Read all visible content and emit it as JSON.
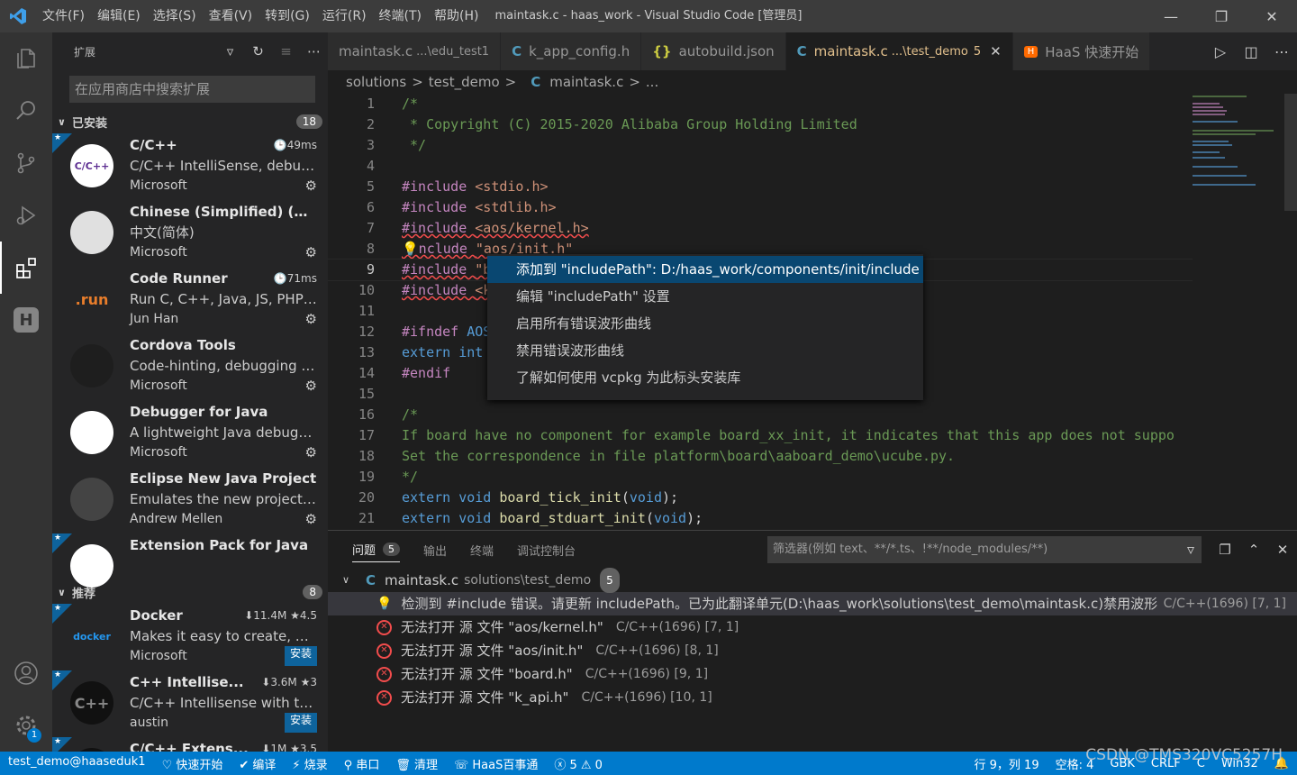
{
  "window": {
    "title": "maintask.c - haas_work - Visual Studio Code [管理员]",
    "menu": [
      "文件(F)",
      "编辑(E)",
      "选择(S)",
      "查看(V)",
      "转到(G)",
      "运行(R)",
      "终端(T)",
      "帮助(H)"
    ]
  },
  "sidebar": {
    "title": "扩展",
    "search_placeholder": "在应用商店中搜索扩展",
    "installed": {
      "label": "已安装",
      "count": "18",
      "items": [
        {
          "name": "C/C++",
          "meta": "🕒49ms",
          "desc": "C/C++ IntelliSense, debuggi...",
          "publisher": "Microsoft",
          "icon_text": "C/C++",
          "starred": true
        },
        {
          "name": "Chinese (Simplified) (简...",
          "desc": "中文(简体)",
          "publisher": "Microsoft",
          "icon_text": "",
          "starred": false
        },
        {
          "name": "Code Runner",
          "meta": "🕒71ms",
          "desc": "Run C, C++, Java, JS, PHP, P...",
          "publisher": "Jun Han",
          "icon_text": ".run",
          "starred": false
        },
        {
          "name": "Cordova Tools",
          "desc": "Code-hinting, debugging an...",
          "publisher": "Microsoft",
          "icon_text": "",
          "starred": false
        },
        {
          "name": "Debugger for Java",
          "desc": "A lightweight Java debugge...",
          "publisher": "Microsoft",
          "icon_text": "",
          "starred": false
        },
        {
          "name": "Eclipse New Java Project",
          "desc": "Emulates the new project bu...",
          "publisher": "Andrew Mellen",
          "icon_text": "",
          "starred": false
        },
        {
          "name": "Extension Pack for Java",
          "desc": "",
          "publisher": "",
          "icon_text": "",
          "starred": true
        }
      ]
    },
    "recommended": {
      "label": "推荐",
      "count": "8",
      "items": [
        {
          "name": "Docker",
          "meta": "⬇11.4M ★4.5",
          "desc": "Makes it easy to create, man...",
          "publisher": "Microsoft",
          "install": "安装",
          "icon_text": "docker"
        },
        {
          "name": "C++ Intellise...",
          "meta": "⬇3.6M ★3",
          "desc": "C/C++ Intellisense with the ...",
          "publisher": "austin",
          "install": "安装",
          "icon_text": "C++"
        },
        {
          "name": "C/C++ Extens...",
          "meta": "⬇1M ★3.5",
          "desc": "",
          "publisher": "",
          "install": "",
          "icon_text": ""
        }
      ]
    }
  },
  "tabs": [
    {
      "label": "maintask.c",
      "path": "...\\edu_test1",
      "type": "plain",
      "active": false
    },
    {
      "label": "k_app_config.h",
      "path": "",
      "type": "c",
      "active": false
    },
    {
      "label": "autobuild.json",
      "path": "",
      "type": "json",
      "active": false
    },
    {
      "label": "maintask.c",
      "path": "...\\test_demo",
      "type": "c",
      "active": true,
      "modified": "5"
    },
    {
      "label": "HaaS 快速开始",
      "path": "",
      "type": "haas",
      "active": false
    }
  ],
  "breadcrumb": [
    "solutions",
    ">",
    "test_demo",
    ">",
    "C",
    "maintask.c",
    ">",
    "..."
  ],
  "code_lines": [
    {
      "n": "1",
      "parts": [
        {
          "c": "cm",
          "t": "/*"
        }
      ]
    },
    {
      "n": "2",
      "parts": [
        {
          "c": "cm",
          "t": " * Copyright (C) 2015-2020 Alibaba Group Holding Limited"
        }
      ]
    },
    {
      "n": "3",
      "parts": [
        {
          "c": "cm",
          "t": " */"
        }
      ]
    },
    {
      "n": "4",
      "parts": []
    },
    {
      "n": "5",
      "parts": [
        {
          "c": "pp",
          "t": "#include "
        },
        {
          "c": "str",
          "t": "<stdio.h>"
        }
      ]
    },
    {
      "n": "6",
      "parts": [
        {
          "c": "pp",
          "t": "#include "
        },
        {
          "c": "str",
          "t": "<stdlib.h>"
        }
      ]
    },
    {
      "n": "7",
      "parts": [
        {
          "c": "pp squig",
          "t": "#include "
        },
        {
          "c": "str squig",
          "t": "<aos/kernel.h>"
        }
      ]
    },
    {
      "n": "8",
      "parts": [
        {
          "c": "pp squig",
          "t": "💡nclude "
        },
        {
          "c": "str squig",
          "t": "\"aos/init.h\""
        }
      ]
    },
    {
      "n": "9",
      "parts": [
        {
          "c": "pp squig",
          "t": "#include "
        },
        {
          "c": "str squig",
          "t": "\"board.h\""
        }
      ]
    },
    {
      "n": "10",
      "parts": [
        {
          "c": "pp squig",
          "t": "#include "
        },
        {
          "c": "str squig",
          "t": "<k_api.h>"
        }
      ]
    },
    {
      "n": "11",
      "parts": []
    },
    {
      "n": "12",
      "parts": [
        {
          "c": "pp",
          "t": "#ifndef "
        },
        {
          "c": "kw",
          "t": "AOS_BINS"
        }
      ]
    },
    {
      "n": "13",
      "parts": [
        {
          "c": "kw",
          "t": "extern int "
        },
        {
          "c": "pl",
          "t": "application_start(int argc, char *argv[]);"
        }
      ]
    },
    {
      "n": "14",
      "parts": [
        {
          "c": "pp",
          "t": "#endif"
        }
      ]
    },
    {
      "n": "15",
      "parts": []
    },
    {
      "n": "16",
      "parts": [
        {
          "c": "cm",
          "t": "/*"
        }
      ]
    },
    {
      "n": "17",
      "parts": [
        {
          "c": "cm",
          "t": "If board have no component for example board_xx_init, it indicates that this app does not suppo"
        }
      ]
    },
    {
      "n": "18",
      "parts": [
        {
          "c": "cm",
          "t": "Set the correspondence in file platform\\board\\aaboard_demo\\ucube.py."
        }
      ]
    },
    {
      "n": "19",
      "parts": [
        {
          "c": "cm",
          "t": "*/"
        }
      ]
    },
    {
      "n": "20",
      "parts": [
        {
          "c": "kw",
          "t": "extern void "
        },
        {
          "c": "fn",
          "t": "board_tick_init"
        },
        {
          "c": "pl",
          "t": "("
        },
        {
          "c": "kw",
          "t": "void"
        },
        {
          "c": "pl",
          "t": ");"
        }
      ]
    },
    {
      "n": "21",
      "parts": [
        {
          "c": "kw",
          "t": "extern void "
        },
        {
          "c": "fn",
          "t": "board_stduart_init"
        },
        {
          "c": "pl",
          "t": "("
        },
        {
          "c": "kw",
          "t": "void"
        },
        {
          "c": "pl",
          "t": ");"
        }
      ]
    }
  ],
  "context_menu": [
    "添加到 \"includePath\": D:/haas_work/components/init/include",
    "编辑 \"includePath\" 设置",
    "启用所有错误波形曲线",
    "禁用错误波形曲线",
    "了解如何使用 vcpkg 为此标头安装库"
  ],
  "panel": {
    "tabs": [
      {
        "label": "问题",
        "count": "5"
      },
      {
        "label": "输出"
      },
      {
        "label": "终端"
      },
      {
        "label": "调试控制台"
      }
    ],
    "filter_placeholder": "筛选器(例如 text、**/*.ts、!**/node_modules/**)",
    "file": {
      "name": "maintask.c",
      "path": "solutions\\test_demo",
      "count": "5"
    },
    "problems": [
      {
        "kind": "warning",
        "msg": "检测到 #include 错误。请更新 includePath。已为此翻译单元(D:\\haas_work\\solutions\\test_demo\\maintask.c)禁用波形曲...",
        "src": "C/C++(1696)  [7, 1]"
      },
      {
        "kind": "error",
        "msg": "无法打开 源 文件 \"aos/kernel.h\"",
        "src": "C/C++(1696)  [7, 1]"
      },
      {
        "kind": "error",
        "msg": "无法打开 源 文件 \"aos/init.h\"",
        "src": "C/C++(1696)  [8, 1]"
      },
      {
        "kind": "error",
        "msg": "无法打开 源 文件 \"board.h\"",
        "src": "C/C++(1696)  [9, 1]"
      },
      {
        "kind": "error",
        "msg": "无法打开 源 文件 \"k_api.h\"",
        "src": "C/C++(1696)  [10, 1]"
      }
    ]
  },
  "statusbar": {
    "left": [
      "test_demo@haaseduk1",
      "♡ 快速开始",
      "✔ 编译",
      "⚡ 烧录",
      "⚲ 串口",
      "🗑 清理",
      "☏ HaaS百事通",
      "ⓧ 5 ⚠ 0"
    ],
    "right": [
      "行 9，列 19",
      "空格: 4",
      "GBK",
      "CRLF",
      "C",
      "Win32"
    ],
    "watermark": "CSDN @TMS320VC5257H"
  },
  "colors": {
    "accent": "#007acc",
    "activity": "#333333",
    "sidebar": "#252526",
    "editor": "#1e1e1e",
    "error": "#f14c4c"
  }
}
